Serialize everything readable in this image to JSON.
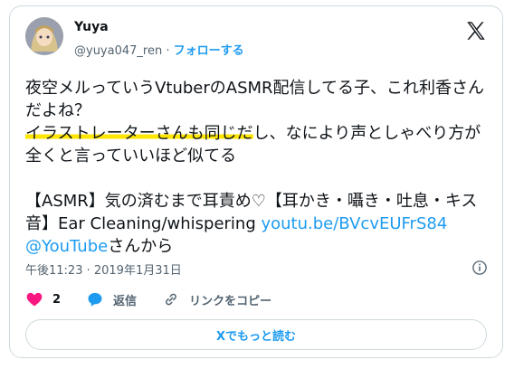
{
  "user": {
    "name": "Yuya",
    "handle": "@yuya047_ren",
    "separator": " · ",
    "follow_label": "フォローする"
  },
  "tweet": {
    "line1": "夜空メルっていうVtuberのASMR配信してる子、これ利香さんだよね？",
    "highlight": "イラストレーターさんも同じだ",
    "line2_rest": "し、なにより声としゃべり方が全くと言っていいほど似てる",
    "video_title": "【ASMR】気の済むまで耳責め♡【耳かき・囁き・吐息・キス音】Ear Cleaning/whispering ",
    "link": "youtu.be/BVcvEUFrS84",
    "mention": "@YouTube",
    "suffix": "さんから"
  },
  "timestamp": "午後11:23 · 2019年1月31日",
  "actions": {
    "like_count": "2",
    "reply_label": "返信",
    "copy_link_label": "リンクをコピー"
  },
  "read_more_label": "Xでもっと読む",
  "colors": {
    "accent": "#1d9bf0",
    "like": "#f91880",
    "highlight": "#ffe600"
  }
}
